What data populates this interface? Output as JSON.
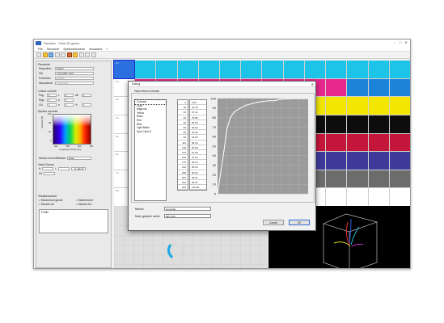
{
  "app": {
    "title": "Fabulator - Show 3D gamut"
  },
  "menu": [
    "File",
    "Strumenti",
    "Spettrofotometro",
    "Visualizza",
    "?"
  ],
  "left_panel": {
    "params_title": "Parametri",
    "dispositivo_label": "Dispositivo",
    "dispositivo_value": "Printer",
    "file_label": "File",
    "file_value": "\"Cd+1000_Test\"",
    "precisione_label": "Precisione",
    "precisione_value": "Default",
    "misurazione_label": "Misurazione",
    "misurazione_value": "Predefinito",
    "letture_title": "Letture correnti",
    "lettura_rows": [
      {
        "k": "Pag",
        "v": "1",
        "k2": "L",
        "v2": "1",
        "k3": "dE",
        "v3": "1"
      },
      {
        "k": "Riga",
        "v": "1",
        "k2": "a",
        "v2": "1",
        "k3": "",
        "v3": ""
      },
      {
        "k": "Col",
        "v": "1",
        "k2": "b",
        "v2": "1",
        "k3": "%",
        "v3": "1"
      }
    ],
    "spettro_title": "Spettro corrente",
    "spettro_ylabel": "Intensità (%)",
    "spettro_xlabel": "Lunghezza d'onda (nm)",
    "spettro_yticks": [
      "120",
      "80",
      "40",
      "0"
    ],
    "spettro_xticks": [
      "400",
      "500",
      "600",
      "700"
    ],
    "mostra_curva_label": "Mostra curva riflettanza",
    "mostra_curva_value": "Riga",
    "valori_title": "Valori Gamut",
    "valori_row": {
      "k1": "H",
      "k2": "L",
      "btn": "In gamut",
      "k3": "Gd"
    },
    "visualizzazione_title": "Visualizzazione",
    "checks": [
      "Mostra fuori gamut",
      "Mostra bordi",
      "Mostra Lab",
      "Mostra HLC"
    ],
    "profile_title": "Profilo"
  },
  "grid": {
    "rows": [
      {
        "label": "1-1",
        "colors": [
          "#2b6fe0",
          "#1ec3e8",
          "#1ec3e8",
          "#1ec3e8",
          "#1ec3e8",
          "#1ec3e8",
          "#1ec3e8",
          "#1ec3e8",
          "#1ec3e8",
          "#1ec3e8",
          "#1ec3e8",
          "#1ec3e8",
          "#1ec3e8",
          "#1ec3e8"
        ]
      },
      {
        "label": "2-1",
        "colors": [
          "#ffffff",
          "#e7278c",
          "#e7278c",
          "#e7278c",
          "#e7278c",
          "#e7278c",
          "#e7278c",
          "#e7278c",
          "#e7278c",
          "#e7278c",
          "#e7278c",
          "#1c83d8",
          "#1c83d8",
          "#1c83d8"
        ]
      },
      {
        "label": "3-1",
        "colors": [
          "#ffffff",
          "#f2e600",
          "#f2e600",
          "#f2e600",
          "#f2e600",
          "#f2e600",
          "#f2e600",
          "#f2e600",
          "#f2e600",
          "#f2e600",
          "#f2e600",
          "#f2e600",
          "#f2e600",
          "#f2e600"
        ]
      },
      {
        "label": "4-1",
        "colors": [
          "#ffffff",
          "#0d0d0d",
          "#0d0d0d",
          "#0d0d0d",
          "#0d0d0d",
          "#0d0d0d",
          "#0d0d0d",
          "#0d0d0d",
          "#0d0d0d",
          "#0d0d0d",
          "#0d0d0d",
          "#0d0d0d",
          "#0d0d0d",
          "#0d0d0d"
        ]
      },
      {
        "label": "5-1",
        "colors": [
          "#ffffff",
          "#c4163a",
          "#c4163a",
          "#c4163a",
          "#c4163a",
          "#c4163a",
          "#c4163a",
          "#c4163a",
          "#c4163a",
          "#c4163a",
          "#c4163a",
          "#c4163a",
          "#c4163a",
          "#c4163a"
        ]
      },
      {
        "label": "6-1",
        "colors": [
          "#ffffff",
          "#3d3a9a",
          "#3d3a9a",
          "#3d3a9a",
          "#3d3a9a",
          "#3d3a9a",
          "#3d3a9a",
          "#3d3a9a",
          "#3d3a9a",
          "#3d3a9a",
          "#3d3a9a",
          "#3d3a9a",
          "#3d3a9a",
          "#3d3a9a"
        ]
      },
      {
        "label": "7-1",
        "colors": [
          "#ffffff",
          "#6c6c6c",
          "#6c6c6c",
          "#6c6c6c",
          "#6c6c6c",
          "#6c6c6c",
          "#6c6c6c",
          "#6c6c6c",
          "#6c6c6c",
          "#6c6c6c",
          "#6c6c6c",
          "#6c6c6c",
          "#6c6c6c",
          "#6c6c6c"
        ]
      },
      {
        "label": "8-1",
        "colors": [
          "#ffffff",
          "#ffffff",
          "#ffffff",
          "#ffffff",
          "#ffffff",
          "#ffffff",
          "#ffffff",
          "#ffffff",
          "#ffffff",
          "#ffffff",
          "#ffffff",
          "#ffffff",
          "#ffffff",
          "#ffffff"
        ]
      }
    ]
  },
  "dialog": {
    "title": "Dialog",
    "frame_label": "Valori letture inchiostri",
    "colorants": [
      "Colorant",
      "Cyan",
      "Magenta",
      "Yellow",
      "Black",
      "Red",
      "Blue",
      "Light Black",
      "Spot Color 8"
    ],
    "x_values": [
      "0",
      "18",
      "26",
      "36",
      "46",
      "64",
      "80",
      "96",
      "114",
      "128",
      "144",
      "160",
      "176",
      "192",
      "208",
      "224",
      "240",
      "255"
    ],
    "y_values": [
      "0.00",
      "44.90",
      "67.42",
      "79.86",
      "85.65",
      "90.02",
      "92.96",
      "94.55",
      "96.19",
      "96.89",
      "97.63",
      "97.63",
      "99.13",
      "99.53",
      "99.82",
      "99.97",
      "99.91",
      "100.00"
    ],
    "metodo_label": "Metodo",
    "metodo_value": "Generale",
    "modo_label": "Modo gestione utente",
    "modo_value": "MD_DHL",
    "cancel": "Cancel",
    "ok": "OK"
  },
  "chart_data": {
    "type": "line",
    "x": [
      0,
      18,
      26,
      36,
      46,
      64,
      80,
      96,
      114,
      128,
      144,
      160,
      176,
      192,
      208,
      224,
      240,
      255
    ],
    "y": [
      0,
      44.9,
      67.42,
      79.86,
      85.65,
      90.02,
      92.96,
      94.55,
      96.19,
      96.89,
      97.63,
      97.63,
      99.13,
      99.53,
      99.82,
      99.97,
      99.91,
      100
    ],
    "xlim": [
      0,
      255
    ],
    "ylim": [
      0,
      100
    ],
    "yticks": [
      "100",
      "90",
      "80",
      "70",
      "60",
      "50",
      "40",
      "30",
      "20",
      "10",
      "0"
    ],
    "grid": true
  },
  "colors": {
    "accent": "#2b6fe0",
    "plot_bg": "#9b9b9b"
  }
}
